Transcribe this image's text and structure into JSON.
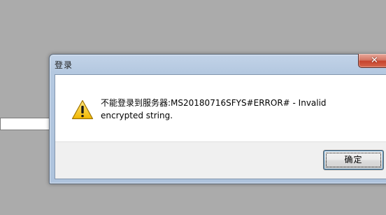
{
  "dialog": {
    "title": "登录",
    "close_icon": "close-icon",
    "message_icon": "warning-icon",
    "message": "不能登录到服务器:MS20180716SFYS#ERROR# - Invalid encrypted string.",
    "ok_label": "确定"
  },
  "colors": {
    "background": "#ababab",
    "title_bar": "#b4c8e0",
    "close_button": "#c7432c",
    "warning_fill": "#f5c400",
    "footer": "#f0f0f0"
  }
}
